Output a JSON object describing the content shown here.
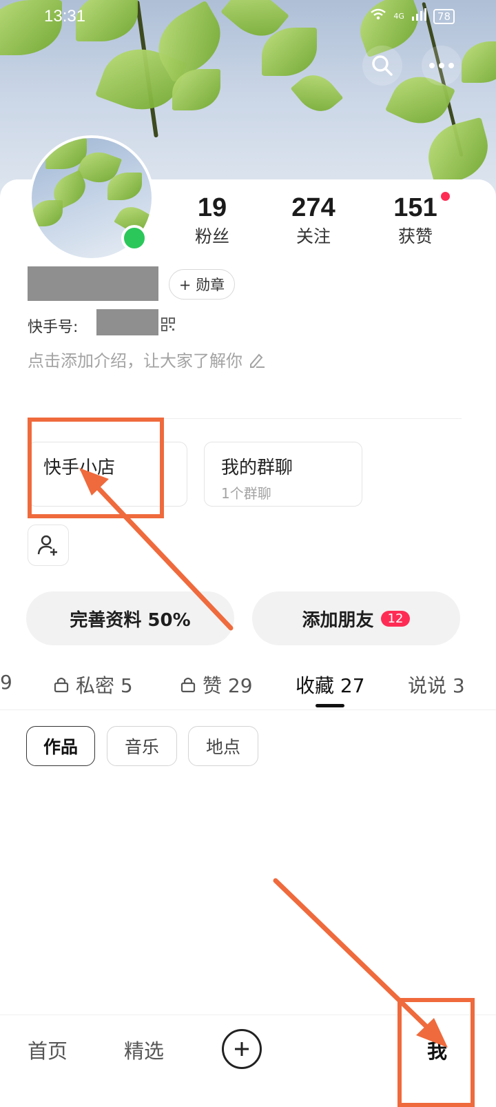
{
  "status_bar": {
    "time": "13:31",
    "network": "4G",
    "battery": "78"
  },
  "profile": {
    "stats": [
      {
        "value": "19",
        "label": "粉丝"
      },
      {
        "value": "274",
        "label": "关注"
      },
      {
        "value": "151",
        "label": "获赞"
      }
    ],
    "badge_button": "+ 勋章",
    "id_label": "快手号:",
    "intro_placeholder": "点击添加介绍，让大家了解你"
  },
  "entries": {
    "shop": {
      "title": "快手小店"
    },
    "group_chat": {
      "title": "我的群聊",
      "subtitle": "1个群聊"
    }
  },
  "actions": {
    "complete_profile": "完善资料 50%",
    "add_friends": "添加朋友",
    "add_friends_badge": "12"
  },
  "tabs": [
    {
      "label": "9"
    },
    {
      "label": "私密 5"
    },
    {
      "label": "赞 29"
    },
    {
      "label": "收藏 27"
    },
    {
      "label": "说说 3"
    }
  ],
  "filter_chips": [
    "作品",
    "音乐",
    "地点"
  ],
  "bottom_nav": [
    "首页",
    "精选",
    "+",
    "我"
  ],
  "colors": {
    "accent_red": "#fe2c55",
    "online_green": "#2bc75a",
    "annotation_orange": "#ef6a3c"
  },
  "icons": [
    "search-icon",
    "more-icon",
    "qr-code-icon",
    "edit-pencil-icon",
    "add-friend-icon",
    "lock-icon",
    "plus-circle-icon"
  ]
}
